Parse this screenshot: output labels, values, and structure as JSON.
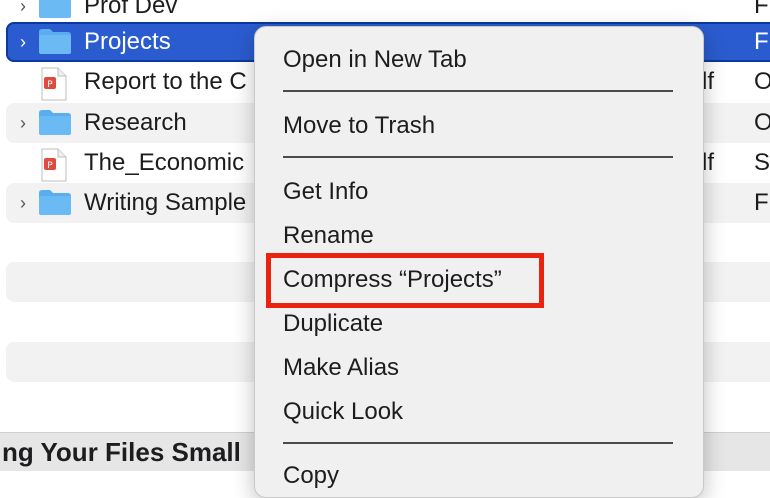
{
  "files": [
    {
      "name": "Prof Dev",
      "type": "folder",
      "ext": "",
      "kind": "F",
      "selected": false,
      "alt": false
    },
    {
      "name": "Projects",
      "type": "folder",
      "ext": "",
      "kind": "F",
      "selected": true,
      "alt": false
    },
    {
      "name": "Report to the C",
      "type": "pdf",
      "ext": "df",
      "kind": "O",
      "selected": false,
      "alt": false
    },
    {
      "name": "Research",
      "type": "folder",
      "ext": "",
      "kind": "O",
      "selected": false,
      "alt": true
    },
    {
      "name": "The_Economic",
      "type": "pdf",
      "ext": "df",
      "kind": "S",
      "selected": false,
      "alt": false
    },
    {
      "name": "Writing Sample",
      "type": "folder",
      "ext": "",
      "kind": "F",
      "selected": false,
      "alt": true
    }
  ],
  "bottom_banner": "ng Your Files Small",
  "context_menu": {
    "items": [
      "Open in New Tab",
      "Move to Trash",
      "Get Info",
      "Rename",
      "Compress “Projects”",
      "Duplicate",
      "Make Alias",
      "Quick Look",
      "Copy"
    ]
  },
  "colors": {
    "selection": "#2b5ccf",
    "folder": "#5aaef0",
    "pdf": "#e04a3f",
    "highlight": "#e8230f"
  }
}
